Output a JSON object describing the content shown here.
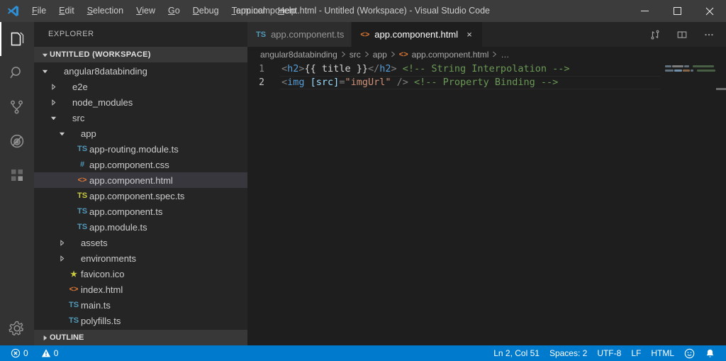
{
  "window": {
    "title": "app.component.html - Untitled (Workspace) - Visual Studio Code",
    "logo_icon": "vscode-logo-icon",
    "minimize_icon": "minimize-icon",
    "maximize_icon": "maximize-icon",
    "close_icon": "close-icon"
  },
  "menubar": {
    "items": [
      {
        "mnemonic": "F",
        "rest": "ile",
        "name": "file"
      },
      {
        "mnemonic": "E",
        "rest": "dit",
        "name": "edit"
      },
      {
        "mnemonic": "S",
        "rest": "election",
        "name": "selection"
      },
      {
        "mnemonic": "V",
        "rest": "iew",
        "name": "view"
      },
      {
        "mnemonic": "G",
        "rest": "o",
        "name": "go"
      },
      {
        "mnemonic": "D",
        "rest": "ebug",
        "name": "debug"
      },
      {
        "mnemonic": "T",
        "rest": "erminal",
        "name": "terminal"
      },
      {
        "mnemonic": "H",
        "rest": "elp",
        "name": "help"
      }
    ]
  },
  "activitybar": {
    "items": [
      {
        "icon": "explorer-files-icon",
        "active": true
      },
      {
        "icon": "search-icon",
        "active": false
      },
      {
        "icon": "source-control-branch-icon",
        "active": false
      },
      {
        "icon": "run-and-debug-icon",
        "active": false
      },
      {
        "icon": "extensions-icon",
        "active": false
      }
    ],
    "manage": {
      "icon": "gear-icon"
    }
  },
  "sidebar": {
    "title": "EXPLORER",
    "workspace_header": "UNTITLED (WORKSPACE)",
    "outline_header": "OUTLINE",
    "tree": [
      {
        "label": "angular8databinding",
        "indent": 1,
        "type": "folder",
        "expanded": true,
        "icon": "folder-icon",
        "selected": false
      },
      {
        "label": "e2e",
        "indent": 2,
        "type": "folder",
        "expanded": false,
        "icon": "folder-icon",
        "selected": false
      },
      {
        "label": "node_modules",
        "indent": 2,
        "type": "folder",
        "expanded": false,
        "icon": "folder-icon",
        "selected": false
      },
      {
        "label": "src",
        "indent": 2,
        "type": "folder",
        "expanded": true,
        "icon": "folder-icon",
        "selected": false
      },
      {
        "label": "app",
        "indent": 3,
        "type": "folder",
        "expanded": true,
        "icon": "folder-icon",
        "selected": false
      },
      {
        "label": "app-routing.module.ts",
        "indent": 4,
        "type": "file",
        "icon": "typescript-file-icon",
        "selected": false
      },
      {
        "label": "app.component.css",
        "indent": 4,
        "type": "file",
        "icon": "css-file-icon",
        "selected": false
      },
      {
        "label": "app.component.html",
        "indent": 4,
        "type": "file",
        "icon": "html-file-icon",
        "selected": true
      },
      {
        "label": "app.component.spec.ts",
        "indent": 4,
        "type": "file",
        "icon": "typescript-test-file-icon",
        "selected": false
      },
      {
        "label": "app.component.ts",
        "indent": 4,
        "type": "file",
        "icon": "typescript-file-icon",
        "selected": false
      },
      {
        "label": "app.module.ts",
        "indent": 4,
        "type": "file",
        "icon": "typescript-file-icon",
        "selected": false
      },
      {
        "label": "assets",
        "indent": 3,
        "type": "folder",
        "expanded": false,
        "icon": "folder-icon",
        "selected": false
      },
      {
        "label": "environments",
        "indent": 3,
        "type": "folder",
        "expanded": false,
        "icon": "folder-icon",
        "selected": false
      },
      {
        "label": "favicon.ico",
        "indent": 3,
        "type": "file",
        "icon": "favicon-star-icon",
        "selected": false
      },
      {
        "label": "index.html",
        "indent": 3,
        "type": "file",
        "icon": "html-file-icon",
        "selected": false
      },
      {
        "label": "main.ts",
        "indent": 3,
        "type": "file",
        "icon": "typescript-file-icon",
        "selected": false
      },
      {
        "label": "polyfills.ts",
        "indent": 3,
        "type": "file",
        "icon": "typescript-file-icon",
        "selected": false
      }
    ]
  },
  "editor": {
    "tabs": [
      {
        "label": "app.component.ts",
        "icon": "typescript-file-icon",
        "icon_text": "TS",
        "active": false,
        "closable": false
      },
      {
        "label": "app.component.html",
        "icon": "html-file-icon",
        "icon_text": "<>",
        "active": true,
        "closable": true
      }
    ],
    "tab_close_glyph": "×",
    "actions": [
      {
        "icon": "split-swap-icon"
      },
      {
        "icon": "split-editor-icon"
      },
      {
        "icon": "more-actions-icon",
        "glyph": "···"
      }
    ],
    "breadcrumbs": [
      {
        "label": "angular8databinding",
        "icon": ""
      },
      {
        "label": "src",
        "icon": ""
      },
      {
        "label": "app",
        "icon": ""
      },
      {
        "label": "app.component.html",
        "icon": "html-file-icon"
      },
      {
        "label": "…",
        "icon": ""
      }
    ],
    "breadcrumb_separator": "❯",
    "lines": [
      {
        "number": "1",
        "current": false,
        "tokens": [
          {
            "t": "<",
            "c": "punc"
          },
          {
            "t": "h2",
            "c": "tag"
          },
          {
            "t": ">",
            "c": "punc"
          },
          {
            "t": "{{ title }}",
            "c": "plain"
          },
          {
            "t": "</",
            "c": "punc"
          },
          {
            "t": "h2",
            "c": "tag"
          },
          {
            "t": ">",
            "c": "punc"
          },
          {
            "t": " ",
            "c": "plain"
          },
          {
            "t": "<!-- String Interpolation -->",
            "c": "comment"
          }
        ]
      },
      {
        "number": "2",
        "current": true,
        "tokens": [
          {
            "t": "<",
            "c": "punc"
          },
          {
            "t": "img",
            "c": "tag"
          },
          {
            "t": " ",
            "c": "plain"
          },
          {
            "t": "[src]",
            "c": "attr"
          },
          {
            "t": "=",
            "c": "punc"
          },
          {
            "t": "\"imgUrl\"",
            "c": "str"
          },
          {
            "t": " ",
            "c": "plain"
          },
          {
            "t": "/>",
            "c": "punc"
          },
          {
            "t": " ",
            "c": "plain"
          },
          {
            "t": "<!-- Property Binding -->",
            "c": "comment"
          }
        ]
      }
    ],
    "minimap": {
      "rows": [
        [
          {
            "w": 9,
            "color": "#6d7f8e"
          },
          {
            "w": 16,
            "color": "#8e8e8e"
          },
          {
            "w": 7,
            "color": "#6d7f8e"
          },
          {
            "w": 3,
            "color": "#1e1e1e"
          },
          {
            "w": 30,
            "color": "#4f6b4a"
          }
        ],
        [
          {
            "w": 12,
            "color": "#6d7f8e"
          },
          {
            "w": 11,
            "color": "#7fa3c4"
          },
          {
            "w": 10,
            "color": "#9a7351"
          },
          {
            "w": 4,
            "color": "#6d7f8e"
          },
          {
            "w": 3,
            "color": "#1e1e1e"
          },
          {
            "w": 26,
            "color": "#4f6b4a"
          }
        ]
      ]
    }
  },
  "statusbar": {
    "left": [
      {
        "icon": "error-icon",
        "label": "0",
        "name": "error-count"
      },
      {
        "icon": "warning-icon",
        "label": "0",
        "name": "warning-count"
      }
    ],
    "right": [
      {
        "label": "Ln 2, Col 51",
        "name": "cursor-position"
      },
      {
        "label": "Spaces: 2",
        "name": "indentation"
      },
      {
        "label": "UTF-8",
        "name": "encoding"
      },
      {
        "label": "LF",
        "name": "eol"
      },
      {
        "label": "HTML",
        "name": "language-mode"
      }
    ],
    "feedback_icon": "smiley-icon",
    "notifications_icon": "bell-icon"
  },
  "colors": {
    "accent": "#007acc",
    "titlebar_bg": "#3c3c3c",
    "sidebar_bg": "#252526",
    "editor_bg": "#1e1e1e",
    "activitybar_bg": "#333333",
    "selection_bg": "#37373d"
  }
}
